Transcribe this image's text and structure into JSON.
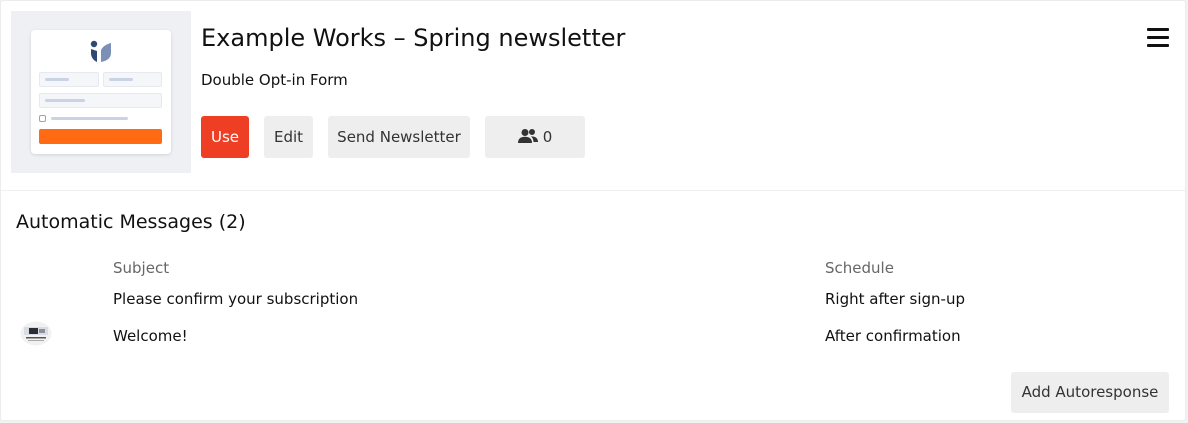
{
  "form": {
    "title": "Example Works – Spring newsletter",
    "type": "Double Opt-in Form",
    "thumbnail_icon": "form-preview-thumbnail",
    "actions": {
      "use_label": "Use",
      "edit_label": "Edit",
      "send_label": "Send Newsletter",
      "members_count": "0"
    },
    "menu_icon": "hamburger-menu-icon"
  },
  "autoresponders": {
    "heading": "Automatic Messages (2)",
    "columns": {
      "subject": "Subject",
      "schedule": "Schedule"
    },
    "rows": [
      {
        "subject": "Please confirm your subscription",
        "schedule": "Right after sign-up"
      },
      {
        "subject": "Welcome!",
        "schedule": "After confirmation"
      }
    ],
    "add_label": "Add Autoresponse"
  },
  "colors": {
    "primary": "#ee3e23",
    "thumbnail_accent": "#ff6a13",
    "logo": "#2f4a72"
  }
}
